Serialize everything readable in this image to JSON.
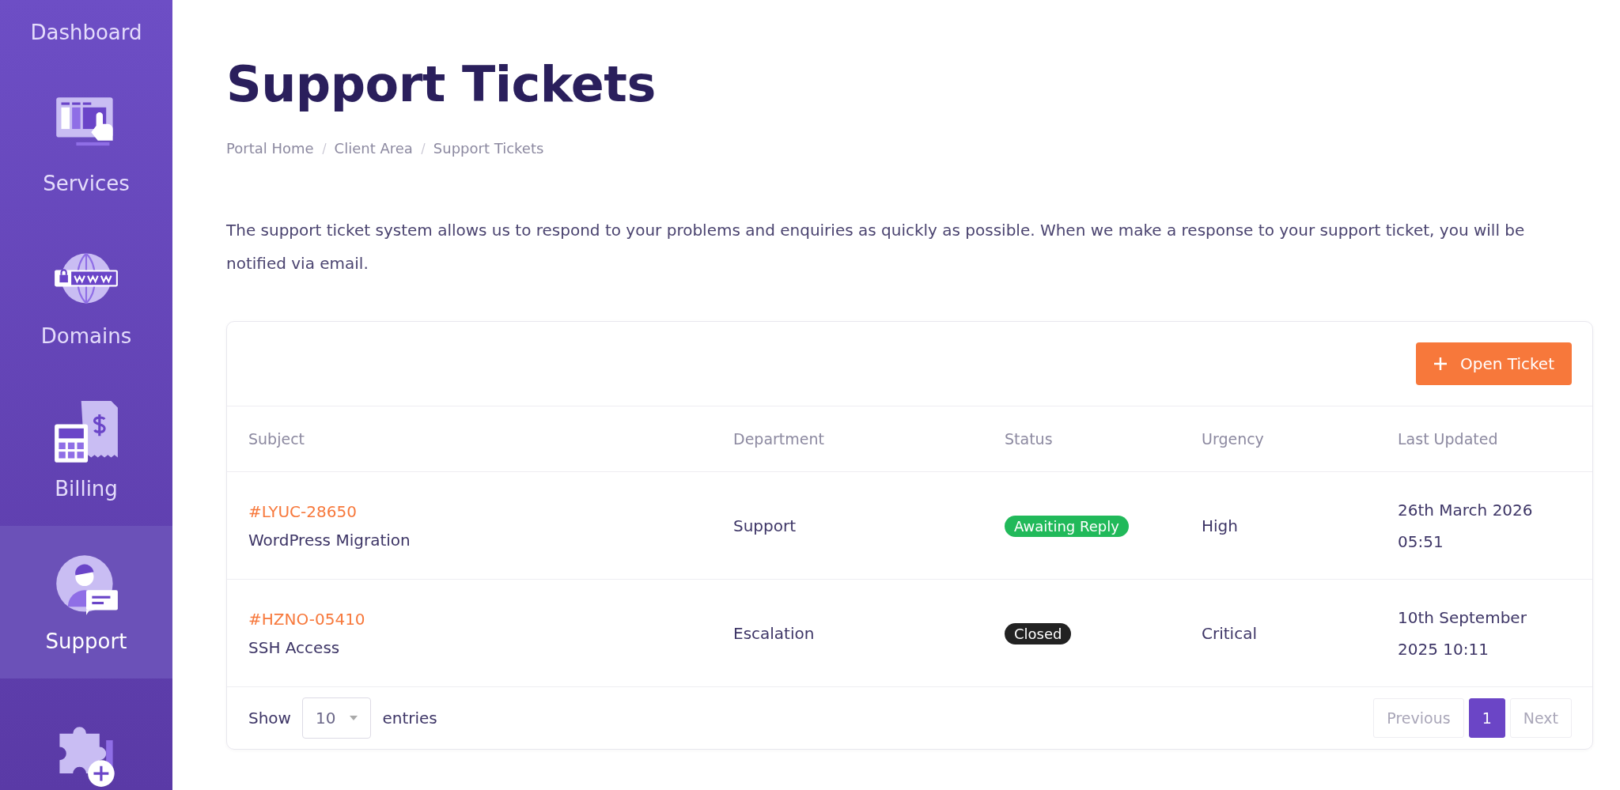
{
  "sidebar": {
    "items": [
      {
        "label": "Dashboard",
        "kind": "text",
        "selected": false
      },
      {
        "label": "Services",
        "kind": "monitor",
        "selected": false
      },
      {
        "label": "Domains",
        "kind": "globe",
        "selected": false
      },
      {
        "label": "Billing",
        "kind": "calculator",
        "selected": false
      },
      {
        "label": "Support",
        "kind": "person",
        "selected": true
      },
      {
        "kind": "puzzle",
        "selected": false
      }
    ]
  },
  "page": {
    "title": "Support Tickets",
    "breadcrumb": [
      "Portal Home",
      "Client Area",
      "Support Tickets"
    ],
    "intro": "The support ticket system allows us to respond to your problems and enquiries as quickly as possible. When we make a response to your support ticket, you will be notified via email."
  },
  "toolbar": {
    "open_ticket_button": "Open Ticket"
  },
  "table": {
    "columns": [
      "Subject",
      "Department",
      "Status",
      "Urgency",
      "Last Updated"
    ],
    "rows": [
      {
        "id": "#LYUC-28650",
        "subject": "WordPress Migration",
        "department": "Support",
        "status": "Awaiting Reply",
        "color": "#21b95a",
        "urgency": "High",
        "last_updated": "26th March 2026 05:51"
      },
      {
        "id": "#HZNO-05410",
        "subject": "SSH Access",
        "department": "Escalation",
        "status": "Closed",
        "color": "#222222",
        "urgency": "Critical",
        "last_updated": "10th September 2025 10:11"
      }
    ]
  },
  "footer": {
    "show_label": "Show",
    "page_size": "10",
    "entries_label": "entries",
    "pagination": [
      {
        "label": "Previous",
        "selected": false,
        "disabled": true
      },
      {
        "label": "1",
        "selected": true,
        "disabled": false
      },
      {
        "label": "Next",
        "selected": false,
        "disabled": true
      }
    ]
  }
}
